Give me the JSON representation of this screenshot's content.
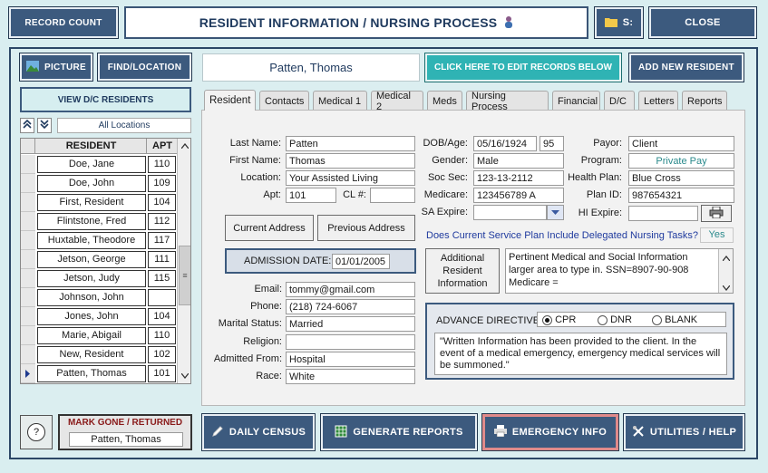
{
  "header": {
    "record_count_label": "RECORD COUNT",
    "title": "RESIDENT INFORMATION / NURSING PROCESS",
    "drive_label": "S:",
    "close_label": "CLOSE"
  },
  "toolbar": {
    "picture_label": "PICTURE",
    "find_location_label": "FIND/LOCATION",
    "resident_name": "Patten, Thomas",
    "edit_records_label": "CLICK HERE TO EDIT RECORDS BELOW",
    "add_new_label": "ADD NEW RESIDENT",
    "view_dc_label": "VIEW D/C RESIDENTS",
    "location_filter": "All Locations"
  },
  "list": {
    "header_resident": "RESIDENT",
    "header_apt": "APT",
    "rows": [
      {
        "name": "Doe, Jane",
        "apt": "110"
      },
      {
        "name": "Doe, John",
        "apt": "109"
      },
      {
        "name": "First, Resident",
        "apt": "104"
      },
      {
        "name": "Flintstone, Fred",
        "apt": "112"
      },
      {
        "name": "Huxtable, Theodore",
        "apt": "117"
      },
      {
        "name": "Jetson, George",
        "apt": "111"
      },
      {
        "name": "Jetson, Judy",
        "apt": "115"
      },
      {
        "name": "Johnson, John",
        "apt": ""
      },
      {
        "name": "Jones, John",
        "apt": "104"
      },
      {
        "name": "Marie, Abigail",
        "apt": "110"
      },
      {
        "name": "New, Resident",
        "apt": "102"
      },
      {
        "name": "Patten, Thomas",
        "apt": "101"
      }
    ]
  },
  "tabs": [
    "Resident",
    "Contacts",
    "Medical 1",
    "Medical 2",
    "Meds",
    "Nursing Process",
    "Financial",
    "D/C",
    "Letters",
    "Reports"
  ],
  "form": {
    "last_name_label": "Last Name:",
    "last_name": "Patten",
    "first_name_label": "First Name:",
    "first_name": "Thomas",
    "location_label": "Location:",
    "location": "Your Assisted Living",
    "apt_label": "Apt:",
    "apt": "101",
    "cl_label": "CL #:",
    "cl": "",
    "dob_label": "DOB/Age:",
    "dob": "05/16/1924",
    "age": "95",
    "gender_label": "Gender:",
    "gender": "Male",
    "soc_sec_label": "Soc Sec:",
    "soc_sec": "123-13-2112",
    "medicare_label": "Medicare:",
    "medicare": "123456789 A",
    "sa_expire_label": "SA Expire:",
    "sa_expire": "",
    "payor_label": "Payor:",
    "payor": "Client",
    "program_label": "Program:",
    "program": "Private Pay",
    "health_plan_label": "Health Plan:",
    "health_plan": "Blue Cross",
    "plan_id_label": "Plan ID:",
    "plan_id": "987654321",
    "hi_expire_label": "HI Expire:",
    "hi_expire": "",
    "current_address_label": "Current Address",
    "previous_address_label": "Previous Address",
    "delegated_question": "Does Current Service Plan Include Delegated Nursing Tasks?",
    "delegated_answer": "Yes",
    "admission_label": "ADMISSION DATE:",
    "admission_date": "01/01/2005",
    "additional_info_label": "Additional Resident Information",
    "additional_info_text": "Pertinent Medical and Social Information larger area to type in. SSN=8907-90-908 Medicare =",
    "email_label": "Email:",
    "email": "tommy@gmail.com",
    "phone_label": "Phone:",
    "phone": "(218) 724-6067",
    "marital_label": "Marital Status:",
    "marital": "Married",
    "religion_label": "Religion:",
    "religion": "",
    "admitted_from_label": "Admitted From:",
    "admitted_from": "Hospital",
    "race_label": "Race:",
    "race": "White",
    "advance_label": "ADVANCE DIRECTIVE:",
    "opt_cpr": "CPR",
    "opt_dnr": "DNR",
    "opt_blank": "BLANK",
    "advance_text": "\"Written Information has been provided to the client. In the event of a medical emergency, emergency medical services will be summoned.\""
  },
  "bottom": {
    "help_symbol": "?",
    "mark_gone_label": "MARK GONE / RETURNED",
    "mark_gone_name": "Patten, Thomas",
    "daily_census_label": "DAILY CENSUS",
    "generate_reports_label": "GENERATE REPORTS",
    "emergency_info_label": "EMERGENCY INFO",
    "utilities_label": "UTILITIES / HELP"
  },
  "colors": {
    "navy": "#3c5a7e",
    "teal": "#2fb3b4",
    "emergency_border": "#e08a8a"
  }
}
